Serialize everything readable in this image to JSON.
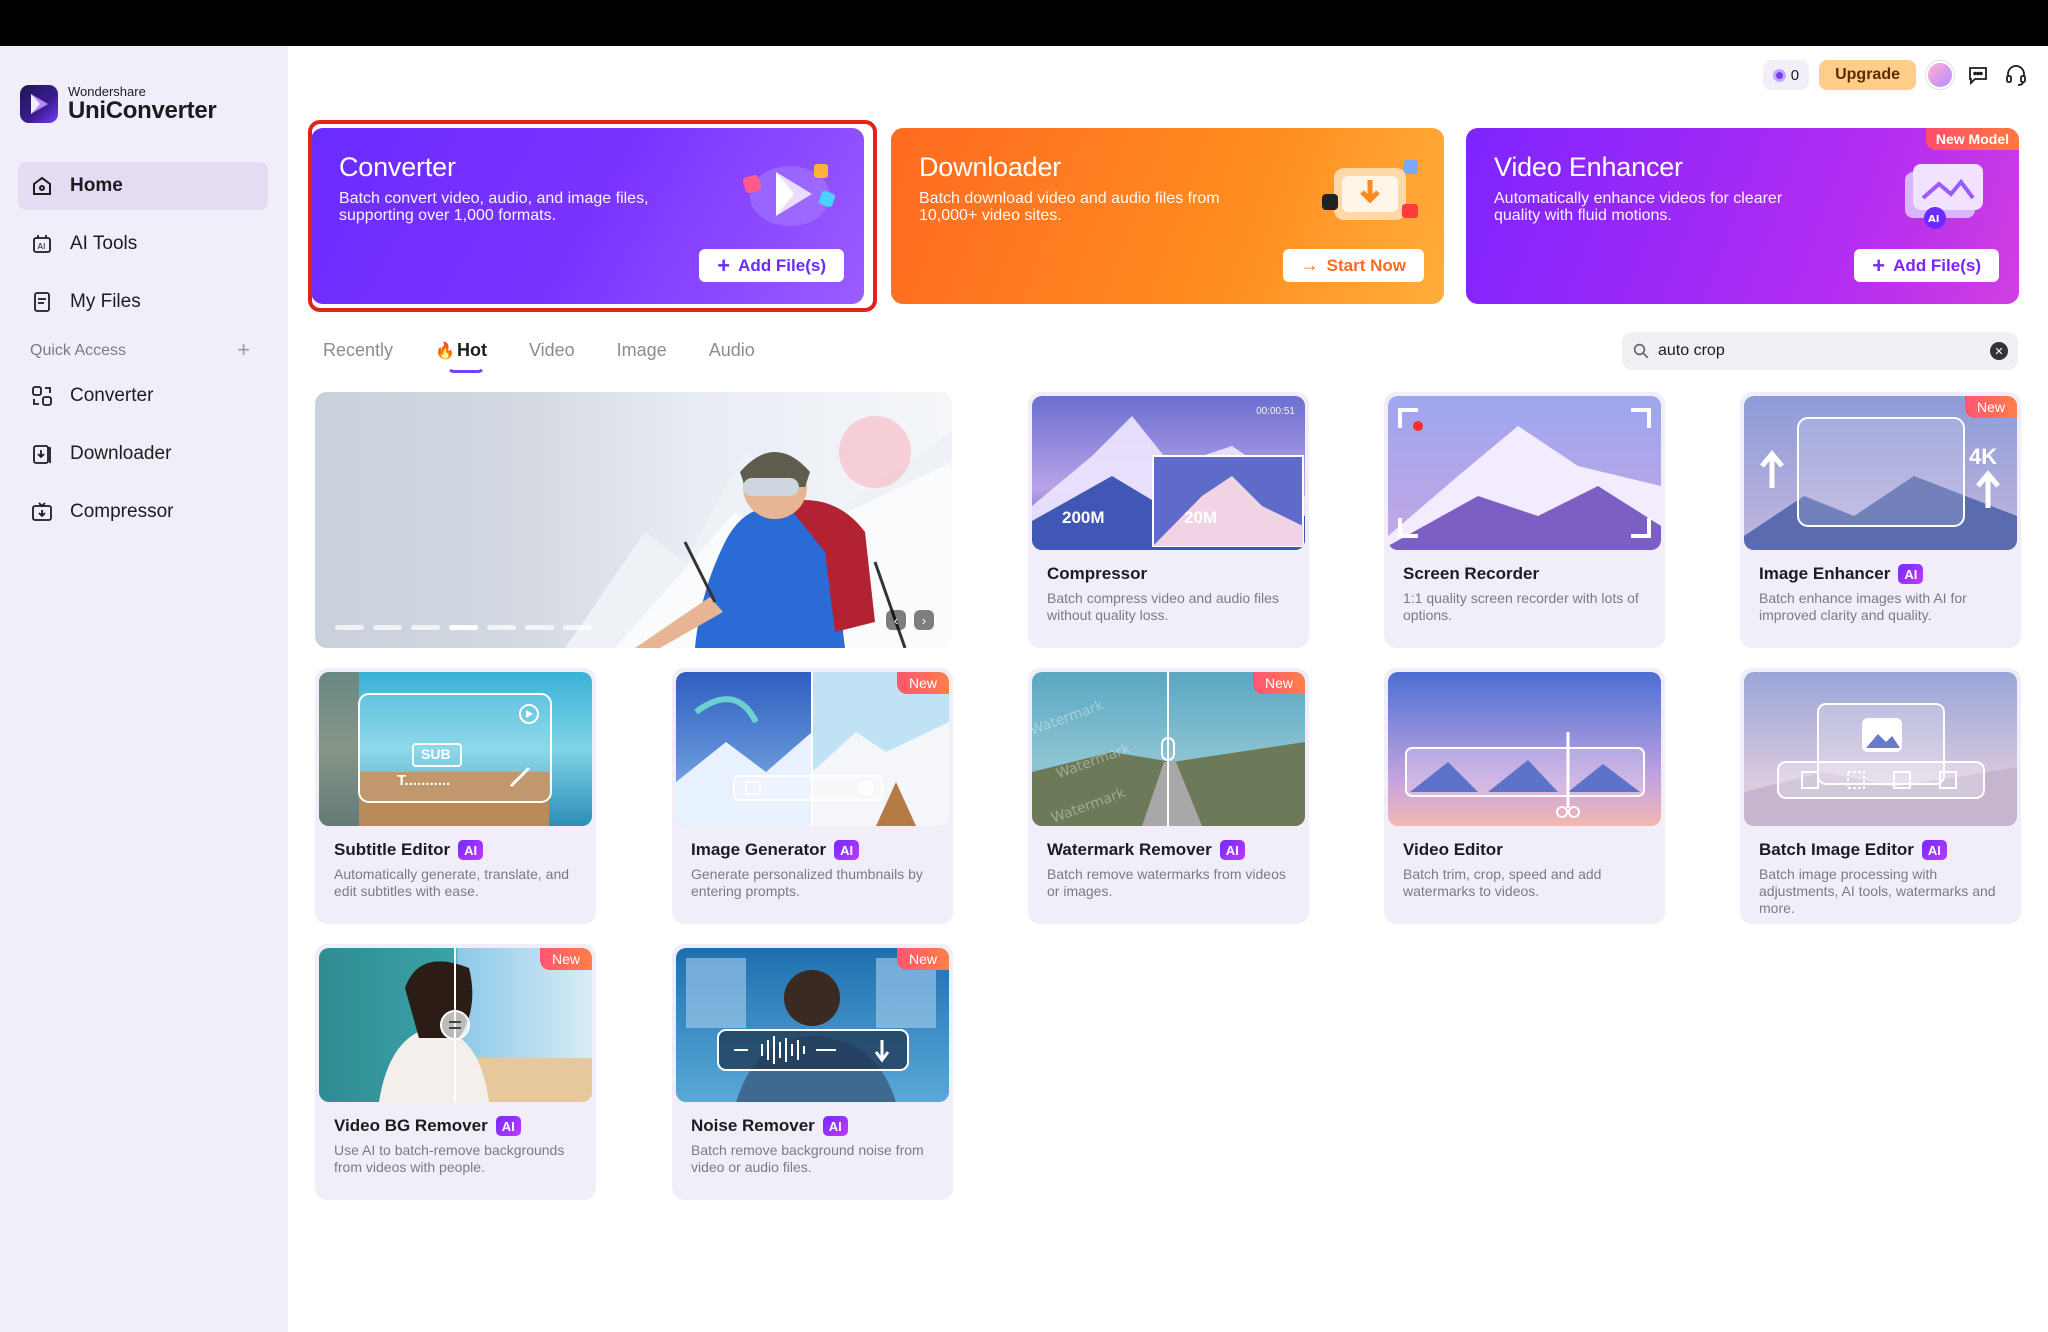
{
  "app": {
    "brand_small": "Wondershare",
    "brand_name": "UniConverter"
  },
  "sidebar": {
    "items": [
      {
        "label": "Home"
      },
      {
        "label": "AI Tools"
      },
      {
        "label": "My Files"
      }
    ],
    "quick_access_title": "Quick Access",
    "quick_access": [
      {
        "label": "Converter"
      },
      {
        "label": "Downloader"
      },
      {
        "label": "Compressor"
      }
    ]
  },
  "header": {
    "coins": "0",
    "upgrade_label": "Upgrade"
  },
  "heroes": [
    {
      "title": "Converter",
      "desc": "Batch convert video, audio, and image files, supporting over 1,000 formats.",
      "button": "Add File(s)"
    },
    {
      "title": "Downloader",
      "desc": "Batch download video and audio files from 10,000+ video sites.",
      "button": "Start Now"
    },
    {
      "title": "Video Enhancer",
      "desc": "Automatically enhance videos for clearer quality with fluid motions.",
      "button": "Add File(s)",
      "badge": "New Model"
    }
  ],
  "tabs": [
    {
      "label": "Recently"
    },
    {
      "label": "Hot"
    },
    {
      "label": "Video"
    },
    {
      "label": "Image"
    },
    {
      "label": "Audio"
    }
  ],
  "search": {
    "value": "auto crop"
  },
  "banner": {
    "slide_index": 4,
    "slide_count": 7
  },
  "cards": [
    {
      "title": "Compressor",
      "desc": "Batch compress video and audio files without quality loss.",
      "ai": false,
      "new": false,
      "time": "00:00:51",
      "size_from": "200M",
      "size_to": "20M"
    },
    {
      "title": "Screen Recorder",
      "desc": "1:1 quality screen recorder with lots of options.",
      "ai": false,
      "new": false
    },
    {
      "title": "Image Enhancer",
      "desc": "Batch enhance images with AI for improved clarity and quality.",
      "ai": true,
      "new": true,
      "badge_4k": "4K"
    },
    {
      "title": "Subtitle Editor",
      "desc": "Automatically generate, translate, and edit subtitles with ease.",
      "ai": true,
      "new": false,
      "sub_label": "SUB",
      "sub_text": "T..........."
    },
    {
      "title": "Image Generator",
      "desc": "Generate personalized thumbnails by entering prompts.",
      "ai": true,
      "new": true
    },
    {
      "title": "Watermark Remover",
      "desc": "Batch remove watermarks from videos or images.",
      "ai": true,
      "new": true,
      "watermark_text": "Watermark"
    },
    {
      "title": "Video Editor",
      "desc": "Batch trim, crop, speed and add watermarks to videos.",
      "ai": false,
      "new": false
    },
    {
      "title": "Batch Image Editor",
      "desc": "Batch image processing with adjustments, AI tools, watermarks and more.",
      "ai": true,
      "new": false
    },
    {
      "title": "Video BG Remover",
      "desc": "Use AI to batch-remove backgrounds from videos with people.",
      "ai": true,
      "new": true
    },
    {
      "title": "Noise Remover",
      "desc": "Batch remove background noise from video or audio files.",
      "ai": true,
      "new": true
    }
  ],
  "labels": {
    "ai": "AI",
    "new": "New"
  },
  "colors": {
    "accent": "#7b3cff",
    "orange": "#ff6a21",
    "highlight_border": "#e3221b"
  }
}
